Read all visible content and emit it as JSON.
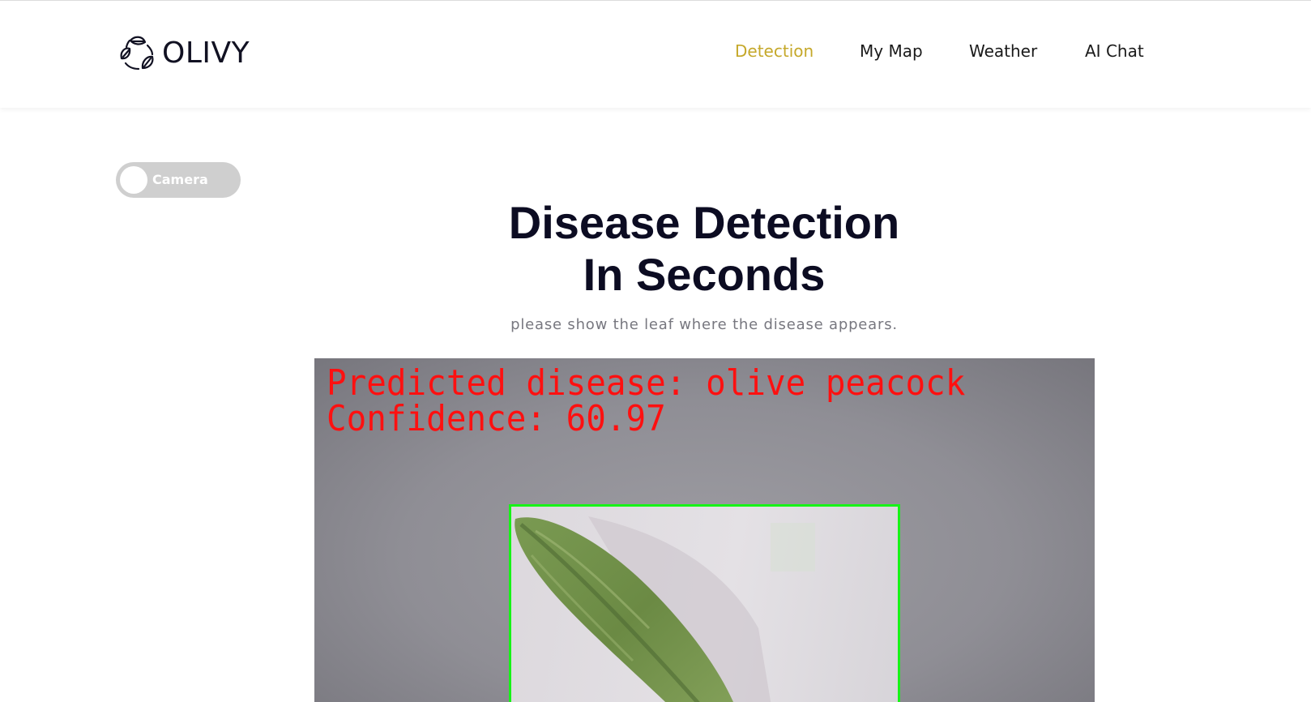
{
  "header": {
    "brand": "OLIVY",
    "nav": [
      {
        "label": "Detection",
        "active": true
      },
      {
        "label": "My Map",
        "active": false
      },
      {
        "label": "Weather",
        "active": false
      },
      {
        "label": "AI Chat",
        "active": false
      }
    ]
  },
  "toggle": {
    "label": "Camera",
    "on": false
  },
  "hero": {
    "title_line1": "Disease Detection",
    "title_line2": "In Seconds",
    "subtitle": "please show the leaf where the disease appears."
  },
  "camera": {
    "prediction_text": "Predicted disease: olive peacock",
    "confidence_text": "Confidence: 60.97"
  },
  "colors": {
    "accent": "#c5a82a",
    "overlay_text": "#ff1010",
    "bounding_box": "#17f317"
  }
}
